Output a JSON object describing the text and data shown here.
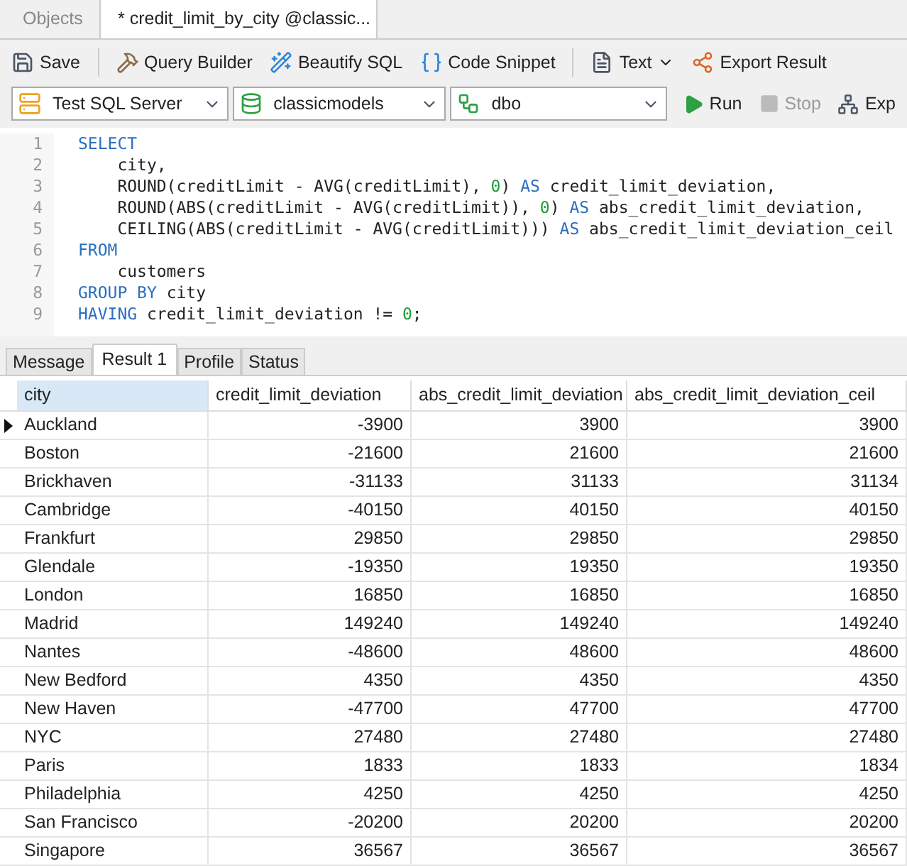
{
  "doc_tabs": [
    {
      "label": "Objects",
      "selected": false,
      "kind": "plain"
    },
    {
      "label": "* credit_limit_by_city @classic...",
      "selected": true,
      "kind": "query"
    }
  ],
  "toolbar": [
    {
      "label": "Save",
      "kind": "save"
    },
    {
      "label": "Query Builder",
      "kind": "builder"
    },
    {
      "label": "Beautify SQL",
      "kind": "beautify"
    },
    {
      "label": "Code Snippet",
      "kind": "snippet"
    },
    {
      "label": "Text",
      "kind": "text"
    },
    {
      "label": "Export Result",
      "kind": "export"
    }
  ],
  "connection": {
    "server": "Test SQL Server",
    "database": "classicmodels",
    "schema": "dbo"
  },
  "run_controls": [
    {
      "label": "Run",
      "kind": "run",
      "disabled": false
    },
    {
      "label": "Stop",
      "kind": "stop",
      "disabled": true
    },
    {
      "label": "Exp",
      "kind": "explain",
      "disabled": false
    }
  ],
  "editor_lines": [
    {
      "number": "1",
      "tokens": [
        {
          "kind": "keyword",
          "text": "SELECT"
        }
      ]
    },
    {
      "number": "2",
      "tokens": [
        {
          "kind": "plain",
          "text": "    city,"
        }
      ]
    },
    {
      "number": "3",
      "tokens": [
        {
          "kind": "plain",
          "text": "    ROUND(creditLimit - AVG(creditLimit), "
        },
        {
          "kind": "number",
          "text": "0"
        },
        {
          "kind": "plain",
          "text": ") "
        },
        {
          "kind": "keyword",
          "text": "AS"
        },
        {
          "kind": "plain",
          "text": " credit_limit_deviation,"
        }
      ]
    },
    {
      "number": "4",
      "tokens": [
        {
          "kind": "plain",
          "text": "    ROUND(ABS(creditLimit - AVG(creditLimit)), "
        },
        {
          "kind": "number",
          "text": "0"
        },
        {
          "kind": "plain",
          "text": ") "
        },
        {
          "kind": "keyword",
          "text": "AS"
        },
        {
          "kind": "plain",
          "text": " abs_credit_limit_deviation,"
        }
      ]
    },
    {
      "number": "5",
      "tokens": [
        {
          "kind": "plain",
          "text": "    CEILING(ABS(creditLimit - AVG(creditLimit))) "
        },
        {
          "kind": "keyword",
          "text": "AS"
        },
        {
          "kind": "plain",
          "text": " abs_credit_limit_deviation_ceil"
        }
      ]
    },
    {
      "number": "6",
      "tokens": [
        {
          "kind": "keyword",
          "text": "FROM"
        }
      ]
    },
    {
      "number": "7",
      "tokens": [
        {
          "kind": "plain",
          "text": "    customers"
        }
      ]
    },
    {
      "number": "8",
      "tokens": [
        {
          "kind": "keyword",
          "text": "GROUP BY"
        },
        {
          "kind": "plain",
          "text": " city"
        }
      ]
    },
    {
      "number": "9",
      "tokens": [
        {
          "kind": "keyword",
          "text": "HAVING"
        },
        {
          "kind": "plain",
          "text": " credit_limit_deviation != "
        },
        {
          "kind": "number",
          "text": "0"
        },
        {
          "kind": "plain",
          "text": ";"
        }
      ]
    }
  ],
  "result_tabs": [
    {
      "label": "Message",
      "selected": false
    },
    {
      "label": "Result 1",
      "selected": true
    },
    {
      "label": "Profile",
      "selected": false
    },
    {
      "label": "Status",
      "selected": false
    }
  ],
  "table": {
    "columns": [
      {
        "label": "city",
        "selected": true
      },
      {
        "label": "credit_limit_deviation",
        "selected": false
      },
      {
        "label": "abs_credit_limit_deviation",
        "selected": false
      },
      {
        "label": "abs_credit_limit_deviation_ceil",
        "selected": false
      }
    ],
    "rows": [
      {
        "selected": true,
        "cells": [
          "Auckland",
          "-3900",
          "3900",
          "3900"
        ]
      },
      {
        "selected": false,
        "cells": [
          "Boston",
          "-21600",
          "21600",
          "21600"
        ]
      },
      {
        "selected": false,
        "cells": [
          "Brickhaven",
          "-31133",
          "31133",
          "31134"
        ]
      },
      {
        "selected": false,
        "cells": [
          "Cambridge",
          "-40150",
          "40150",
          "40150"
        ]
      },
      {
        "selected": false,
        "cells": [
          "Frankfurt",
          "29850",
          "29850",
          "29850"
        ]
      },
      {
        "selected": false,
        "cells": [
          "Glendale",
          "-19350",
          "19350",
          "19350"
        ]
      },
      {
        "selected": false,
        "cells": [
          "London",
          "16850",
          "16850",
          "16850"
        ]
      },
      {
        "selected": false,
        "cells": [
          "Madrid",
          "149240",
          "149240",
          "149240"
        ]
      },
      {
        "selected": false,
        "cells": [
          "Nantes",
          "-48600",
          "48600",
          "48600"
        ]
      },
      {
        "selected": false,
        "cells": [
          "New Bedford",
          "4350",
          "4350",
          "4350"
        ]
      },
      {
        "selected": false,
        "cells": [
          "New Haven",
          "-47700",
          "47700",
          "47700"
        ]
      },
      {
        "selected": false,
        "cells": [
          "NYC",
          "27480",
          "27480",
          "27480"
        ]
      },
      {
        "selected": false,
        "cells": [
          "Paris",
          "1833",
          "1833",
          "1834"
        ]
      },
      {
        "selected": false,
        "cells": [
          "Philadelphia",
          "4250",
          "4250",
          "4250"
        ]
      },
      {
        "selected": false,
        "cells": [
          "San Francisco",
          "-20200",
          "20200",
          "20200"
        ]
      },
      {
        "selected": false,
        "cells": [
          "Singapore",
          "36567",
          "36567",
          "36567"
        ]
      }
    ]
  }
}
